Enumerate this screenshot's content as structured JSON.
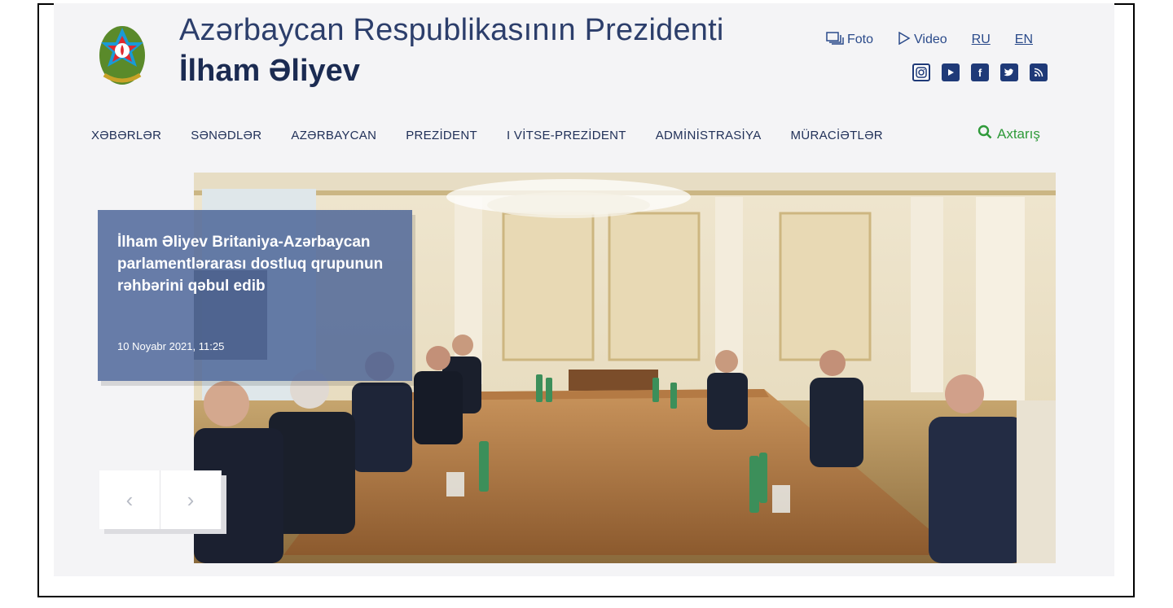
{
  "header": {
    "title_line1": "Azərbaycan Respublikasının Prezidenti",
    "title_line2": "İlham Əliyev"
  },
  "toplinks": [
    {
      "label": "Foto",
      "icon": "photo-stack-icon"
    },
    {
      "label": "Video",
      "icon": "play-icon"
    },
    {
      "label": "RU"
    },
    {
      "label": "EN"
    }
  ],
  "social": [
    "instagram-icon",
    "youtube-icon",
    "facebook-icon",
    "twitter-icon",
    "rss-icon"
  ],
  "nav": {
    "items": [
      "XƏBƏRLƏR",
      "SƏNƏDLƏR",
      "AZƏRBAYCAN",
      "PREZİDENT",
      "I VİTSE-PREZİDENT",
      "ADMİNİSTRASİYA",
      "MÜRACİƏTLƏR"
    ],
    "search_label": "Axtarış"
  },
  "hero": {
    "headline": "İlham Əliyev Britaniya-Azərbaycan parlamentlərarası dostluq qrupunun rəhbərini qəbul edib",
    "date": "10 Noyabr 2021, 11:25"
  },
  "slider": {
    "prev": "‹",
    "next": "›"
  },
  "colors": {
    "brand_blue": "#1f3a78",
    "search_green": "#2f9a3a",
    "caption_bg": "#4862968c"
  }
}
